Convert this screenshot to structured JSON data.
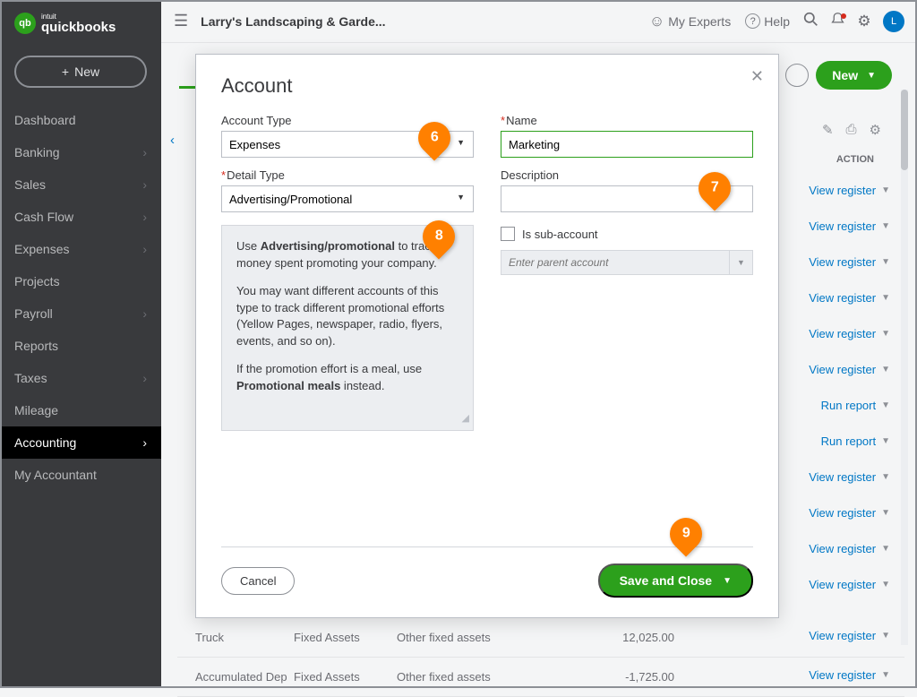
{
  "brand": {
    "small": "intuit",
    "big": "quickbooks",
    "badge": "qb"
  },
  "sidebar": {
    "new_button": "New",
    "items": [
      {
        "label": "Dashboard",
        "chevron": false
      },
      {
        "label": "Banking",
        "chevron": true
      },
      {
        "label": "Sales",
        "chevron": true
      },
      {
        "label": "Cash Flow",
        "chevron": true
      },
      {
        "label": "Expenses",
        "chevron": true
      },
      {
        "label": "Projects",
        "chevron": false
      },
      {
        "label": "Payroll",
        "chevron": true
      },
      {
        "label": "Reports",
        "chevron": false
      },
      {
        "label": "Taxes",
        "chevron": true
      },
      {
        "label": "Mileage",
        "chevron": false
      },
      {
        "label": "Accounting",
        "chevron": true,
        "active": true
      },
      {
        "label": "My Accountant",
        "chevron": false
      }
    ]
  },
  "topbar": {
    "company": "Larry's Landscaping & Garde...",
    "my_experts": "My Experts",
    "help": "Help",
    "avatar_initial": "L"
  },
  "page": {
    "new_button": "New",
    "action_header": "ACTION",
    "row_actions": {
      "view_register": "View register",
      "run_report": "Run report"
    },
    "bottom_rows": [
      {
        "name": "Truck",
        "type": "Fixed Assets",
        "detail": "Other fixed assets",
        "balance": "12,025.00",
        "action": "View register"
      },
      {
        "name": "Accumulated Dep",
        "type": "Fixed Assets",
        "detail": "Other fixed assets",
        "balance": "-1,725.00",
        "action": "View register"
      }
    ]
  },
  "modal": {
    "title": "Account",
    "account_type_label": "Account Type",
    "account_type_value": "Expenses",
    "detail_type_label": "Detail Type",
    "detail_type_value": "Advertising/Promotional",
    "name_label": "Name",
    "name_value": "Marketing",
    "description_label": "Description",
    "description_value": "",
    "sub_account_label": "Is sub-account",
    "parent_placeholder": "Enter parent account",
    "help_html": {
      "p1a": "Use ",
      "p1b": "Advertising/promotional",
      "p1c": " to track money spent promoting your company.",
      "p2": "You may want different accounts of this type to track different promotional efforts (Yellow Pages, newspaper, radio, flyers, events, and so on).",
      "p3a": "If the promotion effort is a meal, use ",
      "p3b": "Promotional meals",
      "p3c": " instead."
    },
    "cancel": "Cancel",
    "save": "Save and Close"
  },
  "steps": {
    "s6": "6",
    "s7": "7",
    "s8": "8",
    "s9": "9"
  }
}
